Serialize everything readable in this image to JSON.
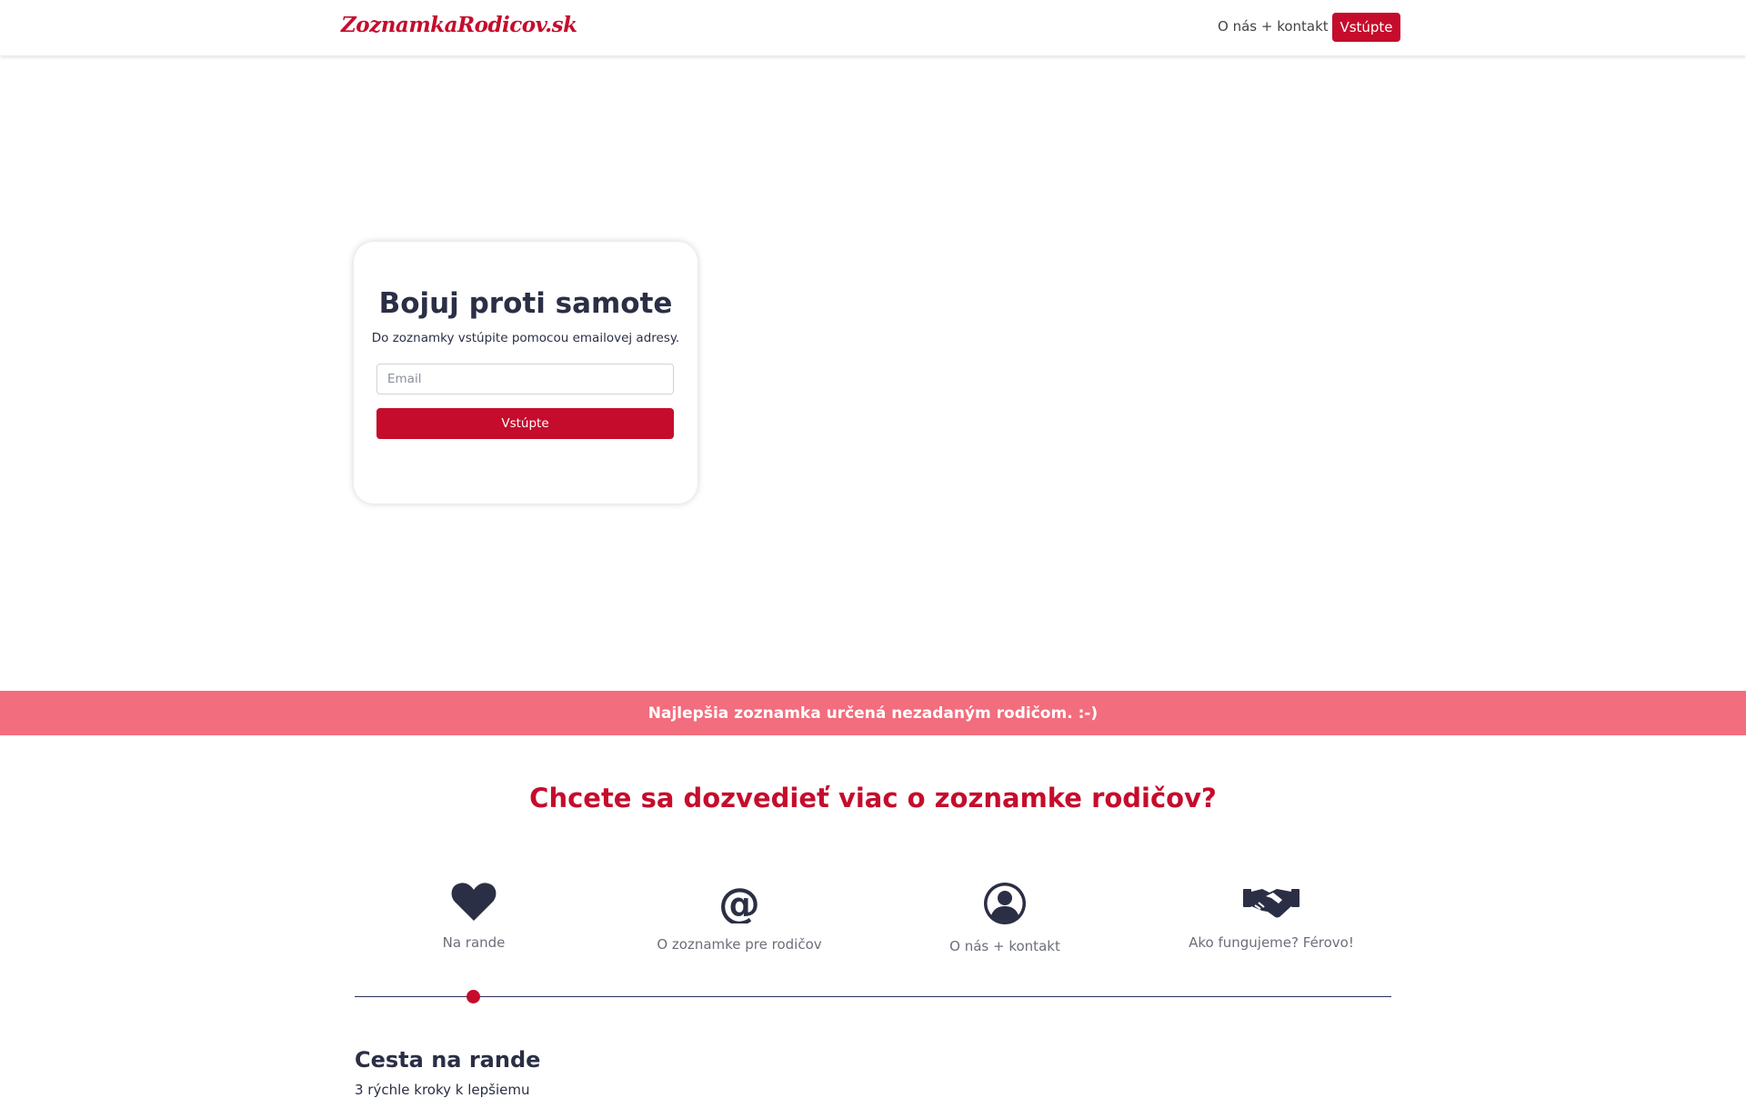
{
  "header": {
    "logo": "ZoznamkaRodicov.sk",
    "nav_link": "O nás + kontakt",
    "nav_button": "Vstúpte"
  },
  "login": {
    "title": "Bojuj proti samote",
    "subtitle": "Do zoznamky vstúpite pomocou emailovej adresy.",
    "email_placeholder": "Email",
    "submit_label": "Vstúpte"
  },
  "banner": {
    "text": "Najlepšia zoznamka určená nezadaným rodičom. :-)"
  },
  "info": {
    "title": "Chcete sa dozvedieť viac o zoznamke rodičov?",
    "features": [
      {
        "label": "Na rande",
        "icon": "heart-icon"
      },
      {
        "label": "O zoznamke pre rodičov",
        "icon": "at-sign-icon"
      },
      {
        "label": "O nás + kontakt",
        "icon": "user-circle-icon"
      },
      {
        "label": "Ako fungujeme? Férovo!",
        "icon": "handshake-icon"
      }
    ],
    "active_index": 0,
    "section_title": "Cesta na rande",
    "section_text": "3 rýchle kroky k lepšiemu"
  },
  "colors": {
    "brand": "#c50c2c",
    "banner": "#f26d7d",
    "text_dark": "#2b2f45"
  }
}
